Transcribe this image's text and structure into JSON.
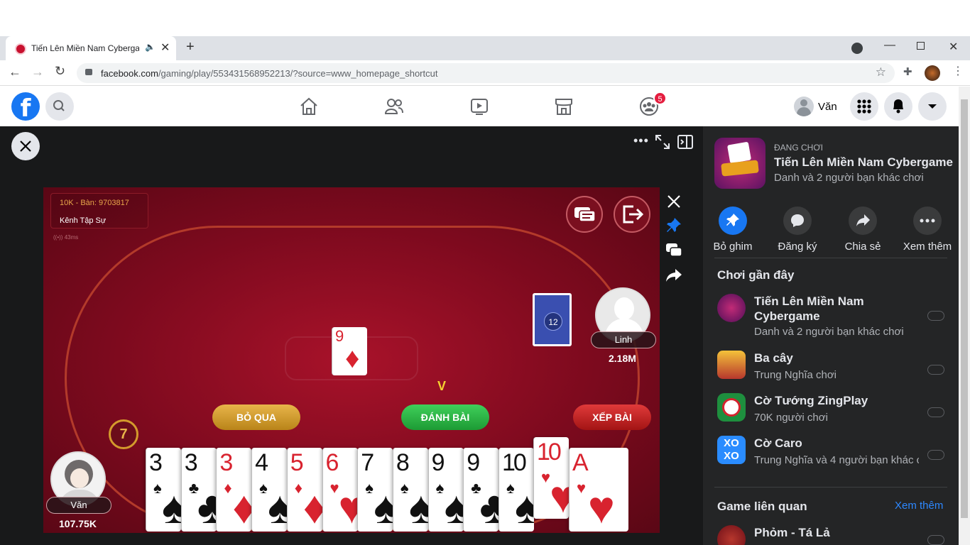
{
  "browser": {
    "tab_title": "Tiến Lên Miền Nam Cybergame",
    "url_host": "facebook.com",
    "url_path": "/gaming/play/553431568952213/?source=www_homepage_shortcut"
  },
  "fbnav": {
    "notification_count": "5",
    "user_name": "Văn"
  },
  "game": {
    "room_id": "10K - Bàn: 9703817",
    "room_name": "Kênh Tập Sự",
    "ping": "43ms",
    "turn_timer": "7",
    "btn_skip": "BỎ QUA",
    "btn_play": "ĐÁNH BÀI",
    "btn_sort": "XẾP BÀI",
    "turn_marker": "V",
    "deck_count": "12",
    "played_card": {
      "rank": "9",
      "suit": "♦",
      "color": "red"
    },
    "opponent": {
      "name": "Linh",
      "money": "2.18M"
    },
    "me": {
      "name": "Văn",
      "money": "107.75K"
    },
    "hand": [
      {
        "rank": "3",
        "suit": "♠",
        "color": "black"
      },
      {
        "rank": "3",
        "suit": "♣",
        "color": "black"
      },
      {
        "rank": "3",
        "suit": "♦",
        "color": "red"
      },
      {
        "rank": "4",
        "suit": "♠",
        "color": "black"
      },
      {
        "rank": "5",
        "suit": "♦",
        "color": "red"
      },
      {
        "rank": "6",
        "suit": "♥",
        "color": "red"
      },
      {
        "rank": "7",
        "suit": "♠",
        "color": "black"
      },
      {
        "rank": "8",
        "suit": "♠",
        "color": "black"
      },
      {
        "rank": "9",
        "suit": "♠",
        "color": "black"
      },
      {
        "rank": "9",
        "suit": "♣",
        "color": "black"
      },
      {
        "rank": "10",
        "suit": "♠",
        "color": "black"
      },
      {
        "rank": "10",
        "suit": "♥",
        "color": "red"
      },
      {
        "rank": "A",
        "suit": "♥",
        "color": "red"
      }
    ]
  },
  "panel": {
    "playing_label": "ĐANG CHƠI",
    "current_game": "Tiến Lên Miền Nam Cybergame",
    "current_desc": "Danh và 2 người bạn khác chơi",
    "actions": [
      "Bỏ ghim",
      "Đăng ký",
      "Chia sẻ",
      "Xem thêm"
    ],
    "recent_title": "Chơi gần đây",
    "recent": [
      {
        "name": "Tiến Lên Miền Nam Cybergame",
        "desc": "Danh và 2 người bạn khác chơi"
      },
      {
        "name": "Ba cây",
        "desc": "Trung Nghĩa chơi"
      },
      {
        "name": "Cờ Tướng ZingPlay",
        "desc": "70K người chơi"
      },
      {
        "name": "Cờ Caro",
        "desc": "Trung Nghĩa và 4 người bạn khác c"
      }
    ],
    "related_title": "Game liên quan",
    "related_more": "Xem thêm",
    "related": [
      {
        "name": "Phỏm - Tá Lả"
      }
    ]
  }
}
